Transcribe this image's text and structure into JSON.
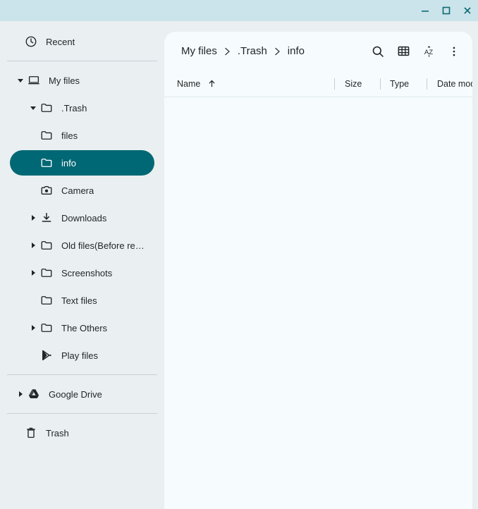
{
  "window": {
    "controls": [
      {
        "name": "minimize",
        "label": "Minimize"
      },
      {
        "name": "maximize",
        "label": "Maximize"
      },
      {
        "name": "close",
        "label": "Close"
      }
    ],
    "titlebar_color": "#cbe3ea"
  },
  "colors": {
    "accent": "#006874",
    "sidebar_bg": "#eaeff1",
    "panel_bg": "#f6fcfd",
    "text": "#1f2527"
  },
  "sidebar": {
    "items": [
      {
        "label": "Recent",
        "icon": "clock-icon",
        "level": 0,
        "twisty": "none",
        "selected": false
      },
      {
        "label": "My files",
        "icon": "computer-icon",
        "level": 1,
        "twisty": "expanded",
        "selected": false
      },
      {
        "label": ".Trash",
        "icon": "folder-icon",
        "level": 2,
        "twisty": "expanded",
        "selected": false
      },
      {
        "label": "files",
        "icon": "folder-icon",
        "level": 3,
        "twisty": "none",
        "selected": false
      },
      {
        "label": "info",
        "icon": "folder-icon",
        "level": 3,
        "twisty": "none",
        "selected": true
      },
      {
        "label": "Camera",
        "icon": "camera-icon",
        "level": 2,
        "twisty": "none",
        "selected": false
      },
      {
        "label": "Downloads",
        "icon": "download-icon",
        "level": 2,
        "twisty": "collapsed",
        "selected": false
      },
      {
        "label": "Old files(Before re…",
        "icon": "folder-icon",
        "level": 2,
        "twisty": "collapsed",
        "selected": false
      },
      {
        "label": "Screenshots",
        "icon": "folder-icon",
        "level": 2,
        "twisty": "collapsed",
        "selected": false
      },
      {
        "label": "Text files",
        "icon": "folder-icon",
        "level": 2,
        "twisty": "none",
        "selected": false
      },
      {
        "label": "The Others",
        "icon": "folder-icon",
        "level": 2,
        "twisty": "collapsed",
        "selected": false
      },
      {
        "label": "Play files",
        "icon": "play-files-icon",
        "level": 2,
        "twisty": "none",
        "selected": false
      },
      {
        "label": "Google Drive",
        "icon": "google-drive-icon",
        "level": 1,
        "twisty": "collapsed",
        "selected": false
      },
      {
        "label": "Trash",
        "icon": "trash-icon",
        "level": 0,
        "twisty": "none",
        "selected": false
      }
    ]
  },
  "toolbar": {
    "breadcrumb": [
      {
        "label": "My files"
      },
      {
        "label": ".Trash"
      },
      {
        "label": "info"
      }
    ],
    "separator": "›",
    "buttons": [
      {
        "name": "search-button",
        "icon": "search-icon",
        "label": "Search"
      },
      {
        "name": "view-toggle-button",
        "icon": "grid-view-icon",
        "label": "Switch to grid view"
      },
      {
        "name": "sort-button",
        "icon": "sort-az-icon",
        "label": "Sort"
      },
      {
        "name": "more-menu-button",
        "icon": "more-vertical-icon",
        "label": "More options"
      }
    ]
  },
  "file_list": {
    "columns": [
      {
        "label": "Name",
        "sorted": true,
        "sort_direction": "ascending"
      },
      {
        "label": "Size",
        "sorted": false
      },
      {
        "label": "Type",
        "sorted": false
      },
      {
        "label": "Date modi…",
        "sorted": false
      }
    ],
    "rows": []
  }
}
